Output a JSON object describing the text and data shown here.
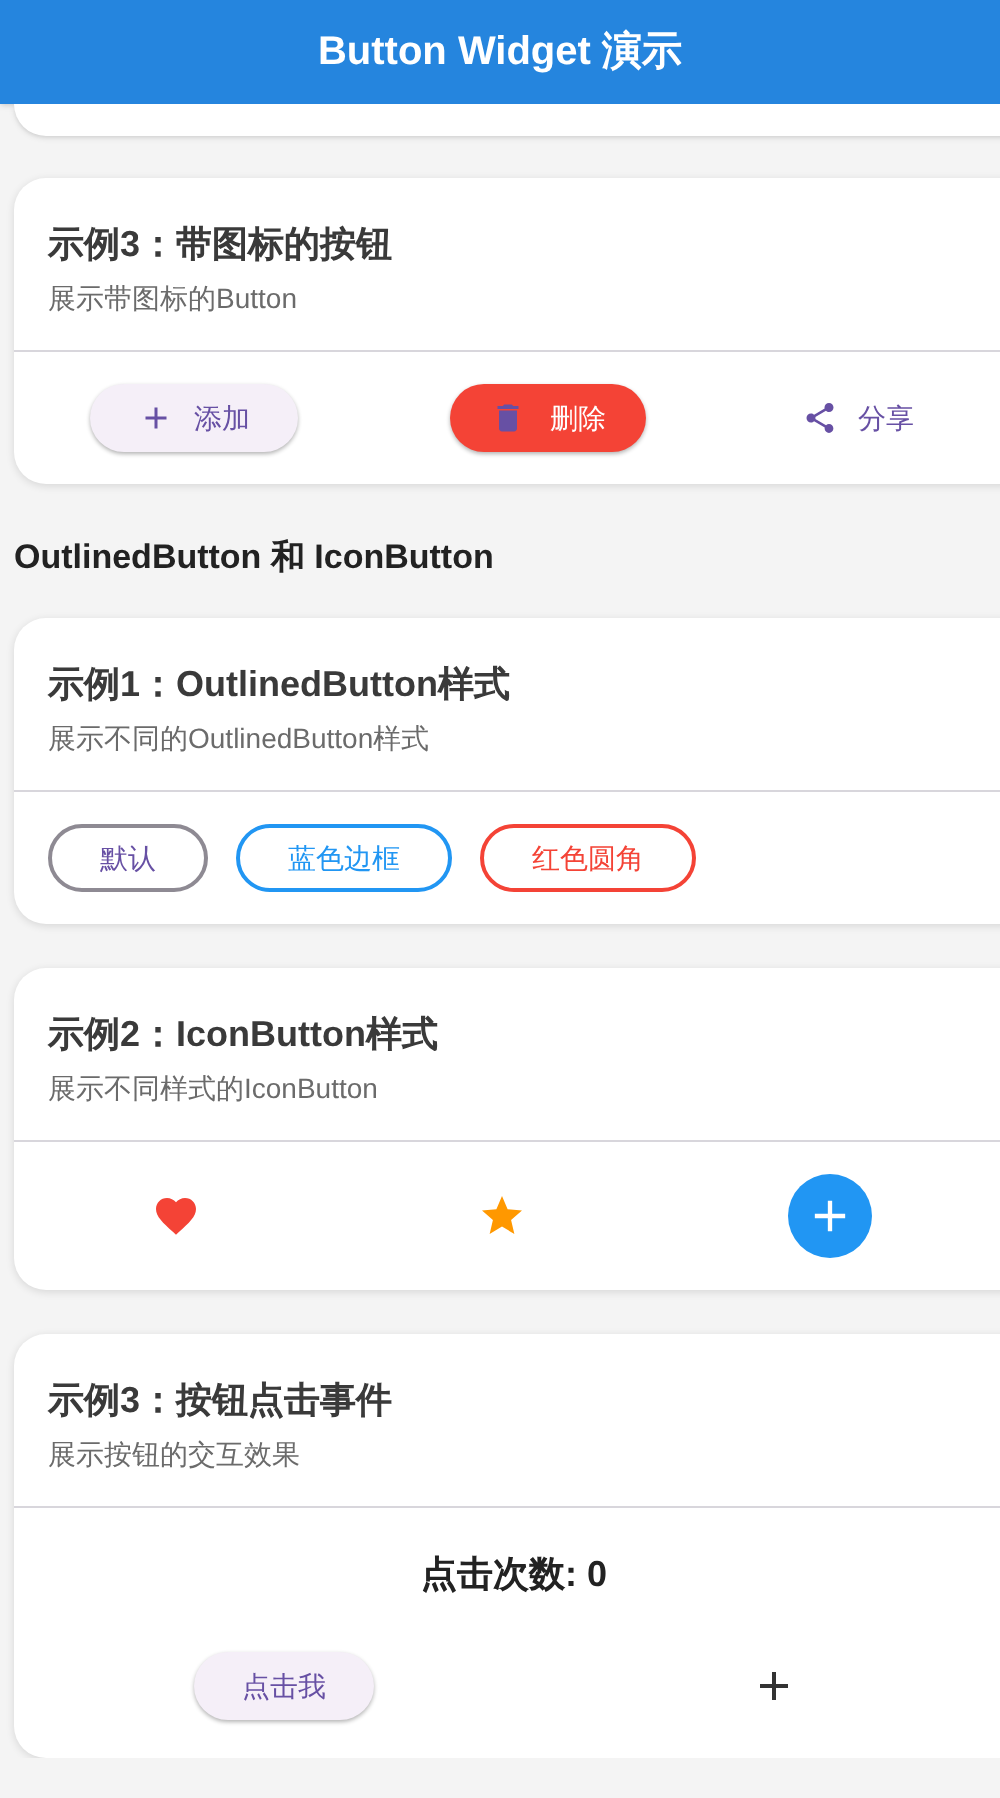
{
  "app_bar": {
    "title": "Button Widget 演示"
  },
  "sections": [
    {
      "kind": "card",
      "title": "示例3：带图标的按钮",
      "subtitle": "展示带图标的Button",
      "rows": [
        {
          "items": [
            {
              "kind": "tonal-plus",
              "label": "添加"
            },
            {
              "kind": "filled-trash",
              "label": "删除",
              "color": "#f44336"
            },
            {
              "kind": "text-share",
              "label": "分享"
            }
          ]
        }
      ]
    },
    {
      "kind": "heading",
      "text": "OutlinedButton 和 IconButton"
    },
    {
      "kind": "card",
      "title": "示例1：OutlinedButton样式",
      "subtitle": "展示不同的OutlinedButton样式",
      "rows": [
        {
          "items": [
            {
              "kind": "outlined",
              "label": "默认",
              "color": "#6750a4"
            },
            {
              "kind": "outlined",
              "label": "蓝色边框",
              "color": "#2196f3"
            },
            {
              "kind": "outlined",
              "label": "红色圆角",
              "color": "#f44336"
            }
          ]
        }
      ]
    },
    {
      "kind": "card",
      "title": "示例2：IconButton样式",
      "subtitle": "展示不同样式的IconButton",
      "rows": [
        {
          "items": [
            {
              "kind": "icon-heart",
              "color": "#f44336"
            },
            {
              "kind": "icon-star",
              "color": "#ff9800"
            },
            {
              "kind": "fab-plus",
              "color": "#2196f3"
            }
          ]
        }
      ]
    },
    {
      "kind": "card",
      "title": "示例3：按钮点击事件",
      "subtitle": "展示按钮的交互效果",
      "rows": [
        {
          "items": [
            {
              "kind": "counter",
              "text": "点击次数: 0"
            }
          ]
        },
        {
          "items": [
            {
              "kind": "tonal",
              "label": "点击我"
            },
            {
              "kind": "icon-plus",
              "color": "#333333"
            }
          ]
        }
      ]
    }
  ]
}
